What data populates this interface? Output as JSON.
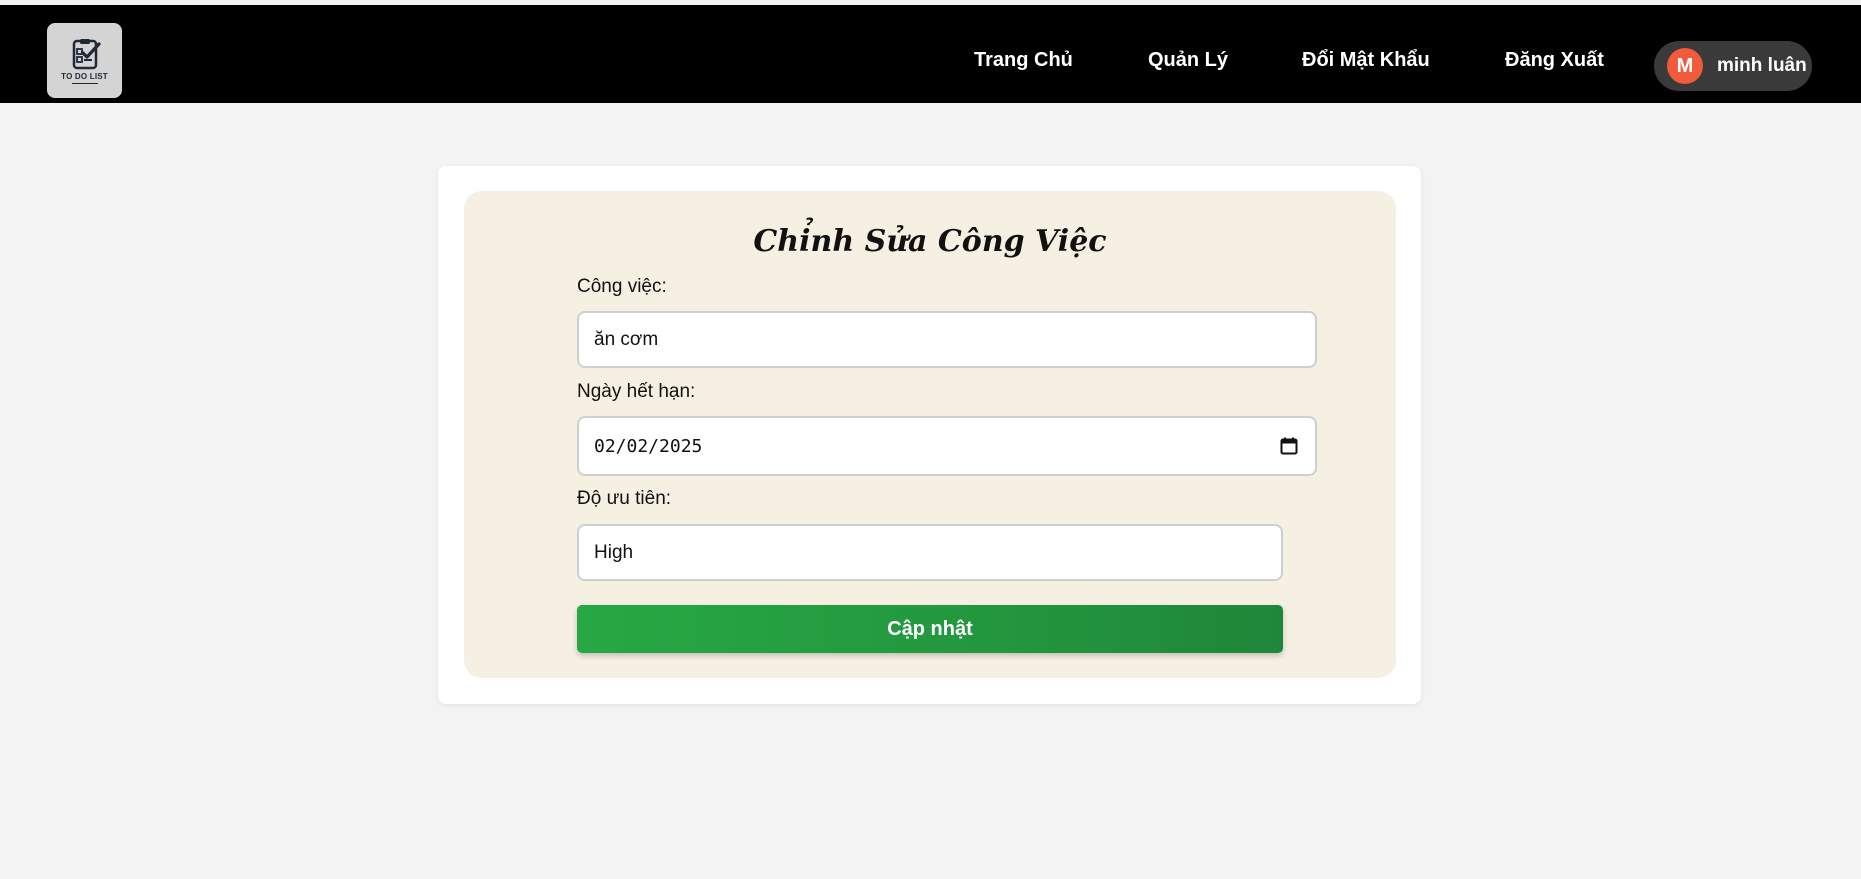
{
  "app": {
    "logo_text": "TO DO LIST"
  },
  "nav": {
    "items": [
      {
        "label": "Trang Chủ"
      },
      {
        "label": "Quản Lý"
      },
      {
        "label": "Đổi Mật Khẩu"
      },
      {
        "label": "Đăng Xuất"
      }
    ]
  },
  "user": {
    "initial": "M",
    "name": "minh luân"
  },
  "form": {
    "title": "Chỉnh Sửa Công Việc",
    "task_label": "Công việc:",
    "task_value": "ăn cơm",
    "due_label": "Ngày hết hạn:",
    "due_value": "02/02/2025",
    "priority_label": "Độ ưu tiên:",
    "priority_value": "High",
    "submit_label": "Cập nhật"
  },
  "colors": {
    "navbar": "#000000",
    "page_background": "#f3f3f3",
    "form_background": "#f6f0e3",
    "avatar": "#f15a3a",
    "submit_button": "#27a844"
  }
}
